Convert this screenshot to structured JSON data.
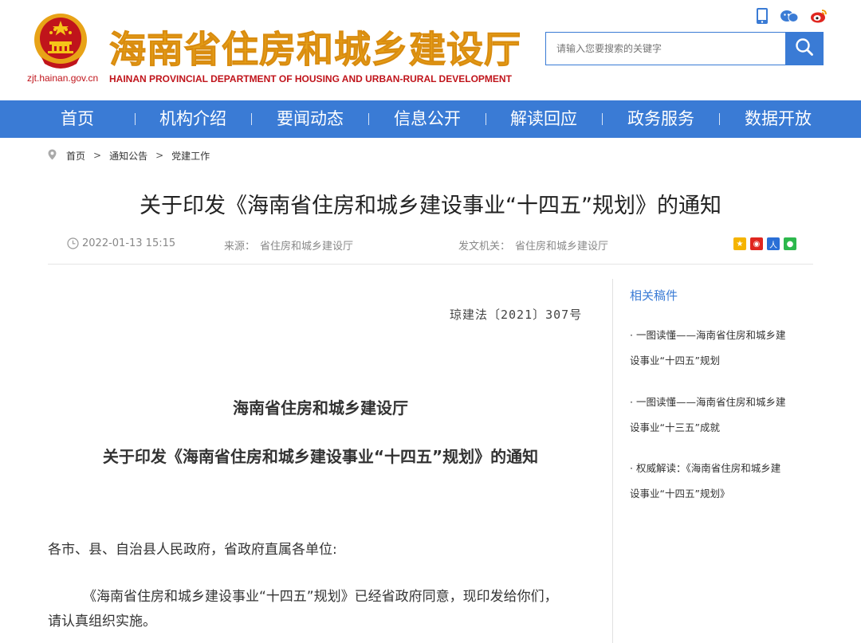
{
  "header": {
    "domain": "zjt.hainan.gov.cn",
    "title": "海南省住房和城乡建设厅",
    "subtitle": "HAINAN PROVINCIAL DEPARTMENT OF HOUSING AND URBAN-RURAL DEVELOPMENT",
    "icons": [
      "mobile-icon",
      "qq-icon",
      "weibo-icon"
    ]
  },
  "search": {
    "placeholder": "请输入您要搜索的关键字",
    "icon": "search-icon"
  },
  "nav": {
    "items": [
      {
        "label": "首页"
      },
      {
        "label": "机构介绍"
      },
      {
        "label": "要闻动态"
      },
      {
        "label": "信息公开"
      },
      {
        "label": "解读回应"
      },
      {
        "label": "政务服务"
      },
      {
        "label": "数据开放"
      }
    ]
  },
  "breadcrumb": {
    "items": [
      "首页",
      "通知公告",
      "党建工作"
    ],
    "separator": ">"
  },
  "article": {
    "title": "关于印发《海南省住房和城乡建设事业“十四五”规划》的通知",
    "date": "2022-01-13 15:15",
    "source_label": "来源：",
    "source": "省住房和城乡建设厅",
    "issuer_label": "发文机关：",
    "issuer": "省住房和城乡建设厅",
    "doc_number": "琼建法〔2021〕307号",
    "org_heading": "海南省住房和城乡建设厅",
    "doc_heading": "关于印发《海南省住房和城乡建设事业“十四五”规划》的通知",
    "salutation": "各市、县、自治县人民政府，省政府直属各单位:",
    "body_line1": "《海南省住房和城乡建设事业“十四五”规划》已经省政府同意，现印发给你们，",
    "body_line2": "请认真组织实施。"
  },
  "share": {
    "icons": [
      "qzone-icon",
      "weibo-share-icon",
      "renren-icon",
      "wechat-icon"
    ]
  },
  "sidebar": {
    "heading": "相关稿件",
    "items": [
      {
        "line1": "· 一图读懂——海南省住房和城乡建",
        "line2": "设事业“十四五”规划"
      },
      {
        "line1": "· 一图读懂——海南省住房和城乡建",
        "line2": "设事业“十三五”成就"
      },
      {
        "line1": "· 权威解读：《海南省住房和城乡建",
        "line2": "设事业“十四五”规划》"
      }
    ]
  },
  "colors": {
    "brand_blue": "#3a7bd5",
    "title_gold": "#e8a317",
    "emblem_red": "#c0141b"
  }
}
